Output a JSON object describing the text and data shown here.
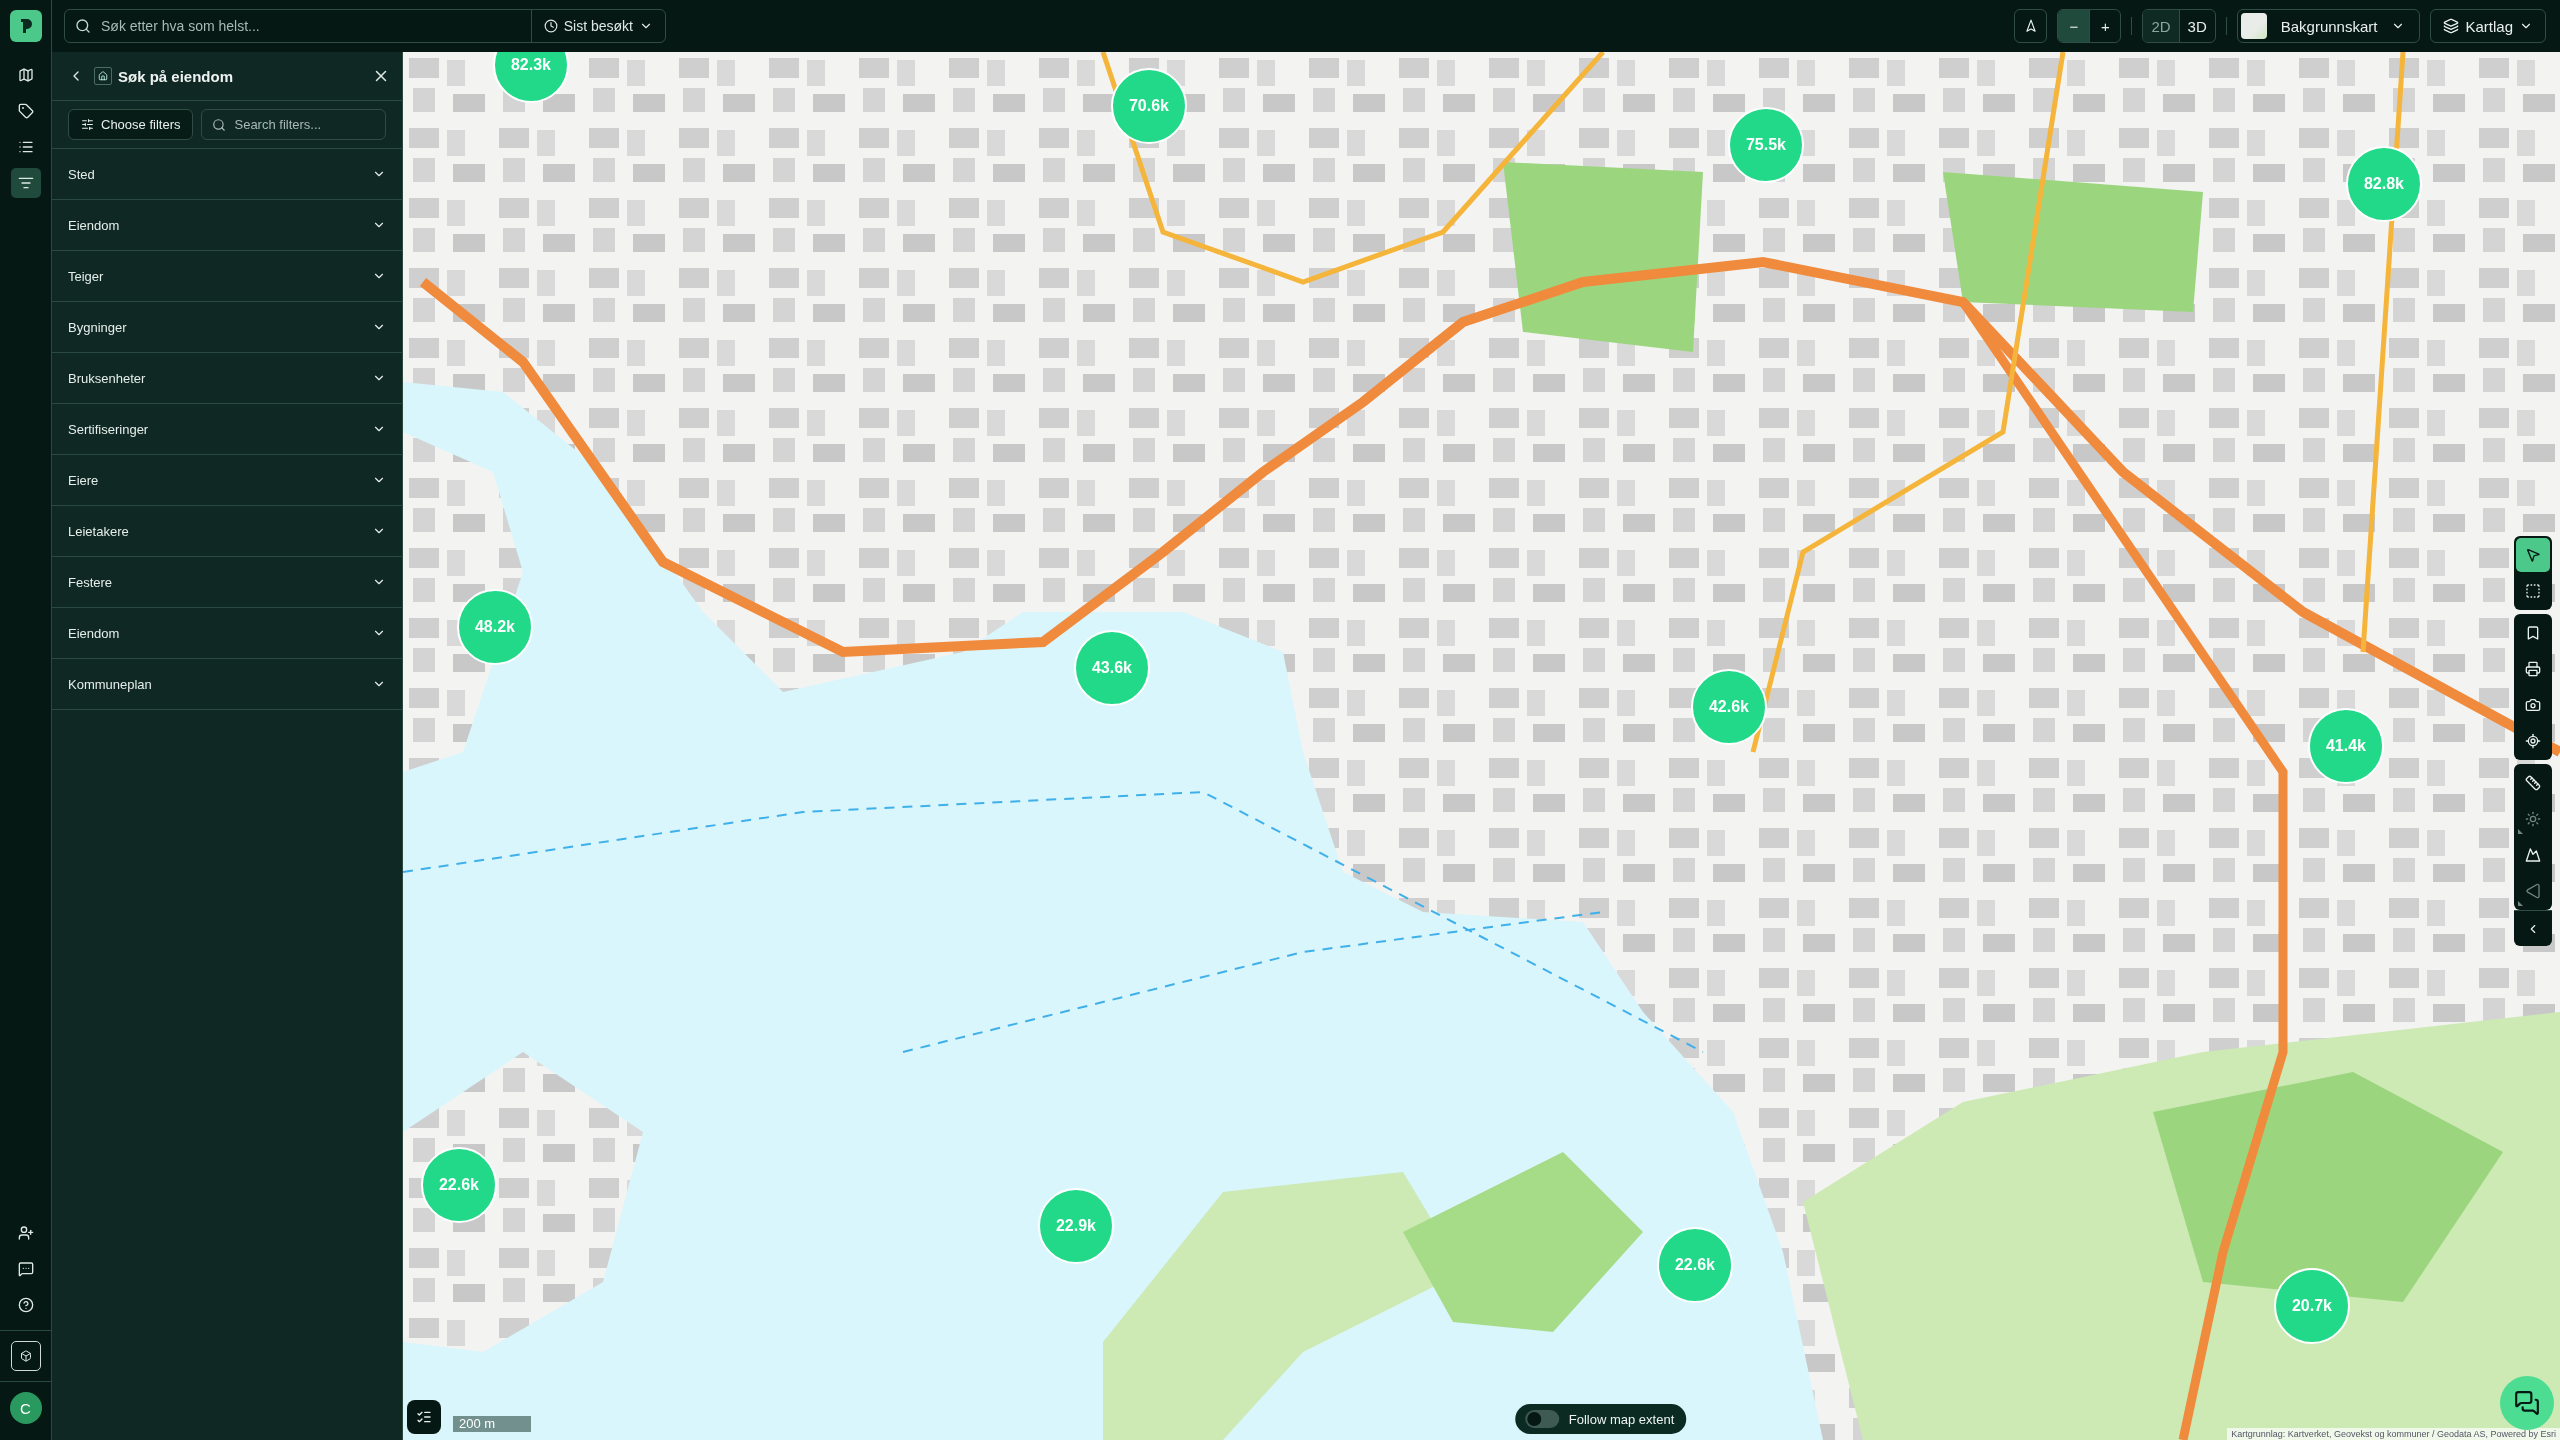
{
  "search": {
    "placeholder": "Søk etter hva som helst...",
    "recent": "Sist besøkt"
  },
  "rail": {
    "top": [
      {
        "selected": false
      },
      {
        "selected": false
      },
      {
        "selected": false
      },
      {
        "selected": true
      }
    ],
    "avatar": "C"
  },
  "panel": {
    "title": "Søk på eiendom",
    "choose_filters": "Choose filters",
    "filter_search": {
      "placeholder": "Search filters..."
    },
    "sections": [
      {
        "label": "Sted",
        "expanded": false
      },
      {
        "label": "Eiendom",
        "expanded": false
      },
      {
        "label": "Teiger",
        "expanded": false
      },
      {
        "label": "Bygninger",
        "expanded": false
      },
      {
        "label": "Bruksenheter",
        "expanded": false
      },
      {
        "label": "Sertifiseringer",
        "expanded": false
      },
      {
        "label": "Eiere",
        "expanded": false
      },
      {
        "label": "Leietakere",
        "expanded": false
      },
      {
        "label": "Festere",
        "expanded": false
      },
      {
        "label": "Eiendom",
        "expanded": false
      },
      {
        "label": "Kommuneplan",
        "expanded": false
      }
    ]
  },
  "map_controls": {
    "zoom": [
      {
        "label": "−",
        "active": true
      },
      {
        "label": "+",
        "active": false
      }
    ],
    "view_modes": [
      {
        "label": "2D",
        "selected": true
      },
      {
        "label": "3D",
        "selected": false
      }
    ],
    "basemap": "Bakgrunnskart",
    "layers": "Kartlag"
  },
  "clusters": [
    {
      "label": "82.3k"
    },
    {
      "label": "70.6k"
    },
    {
      "label": "75.5k"
    },
    {
      "label": "82.8k"
    },
    {
      "label": "48.2k"
    },
    {
      "label": "43.6k"
    },
    {
      "label": "42.6k"
    },
    {
      "label": "41.4k"
    },
    {
      "label": "22.6k"
    },
    {
      "label": "22.9k"
    },
    {
      "label": "22.6k"
    },
    {
      "label": "20.7k"
    }
  ],
  "tool_groups": [
    [
      {
        "selected": true,
        "disabled": false
      },
      {
        "selected": false,
        "disabled": false
      }
    ],
    [
      {
        "selected": false,
        "disabled": false
      },
      {
        "selected": false,
        "disabled": false
      },
      {
        "selected": false,
        "disabled": false
      },
      {
        "selected": false,
        "disabled": false
      }
    ],
    [
      {
        "selected": false,
        "disabled": false
      },
      {
        "selected": false,
        "disabled": true
      },
      {
        "selected": false,
        "disabled": false
      },
      {
        "selected": false,
        "disabled": true
      }
    ]
  ],
  "follow_toggle": {
    "label": "Follow map extent",
    "on": false
  },
  "scale": "200 m",
  "attribution": "Kartgrunnlag: Kartverket, Geovekst og kommuner / Geodata AS, Powered by Esri"
}
